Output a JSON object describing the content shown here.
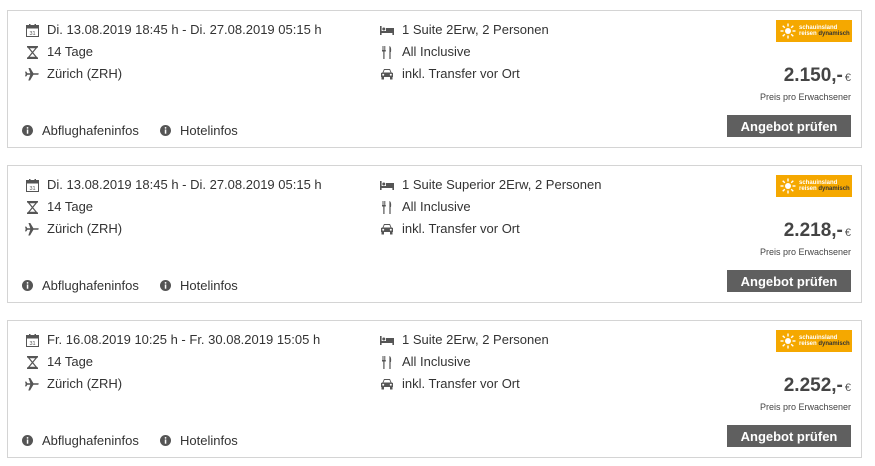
{
  "labels": {
    "airport_info": "Abflughafeninfos",
    "hotel_info": "Hotelinfos",
    "price_note": "Preis pro Erwachsener",
    "check_offer": "Angebot prüfen",
    "currency": "€"
  },
  "logo": {
    "line1": "schauinsland",
    "line2a": "reisen",
    "line2b": "dynamisch"
  },
  "colors": {
    "button": "#5f5f5f",
    "logo_bg": "#f5a800",
    "border": "#d4d4d4"
  },
  "offers": [
    {
      "dates": "Di. 13.08.2019 18:45 h - Di. 27.08.2019 05:15 h",
      "duration": "14 Tage",
      "airport": "Zürich (ZRH)",
      "room": "1 Suite 2Erw, 2 Personen",
      "board": "All Inclusive",
      "transfer": "inkl. Transfer vor Ort",
      "price": "2.150,-"
    },
    {
      "dates": "Di. 13.08.2019 18:45 h - Di. 27.08.2019 05:15 h",
      "duration": "14 Tage",
      "airport": "Zürich (ZRH)",
      "room": "1 Suite Superior 2Erw, 2 Personen",
      "board": "All Inclusive",
      "transfer": "inkl. Transfer vor Ort",
      "price": "2.218,-"
    },
    {
      "dates": "Fr. 16.08.2019 10:25 h - Fr. 30.08.2019 15:05 h",
      "duration": "14 Tage",
      "airport": "Zürich (ZRH)",
      "room": "1 Suite 2Erw, 2 Personen",
      "board": "All Inclusive",
      "transfer": "inkl. Transfer vor Ort",
      "price": "2.252,-"
    }
  ]
}
